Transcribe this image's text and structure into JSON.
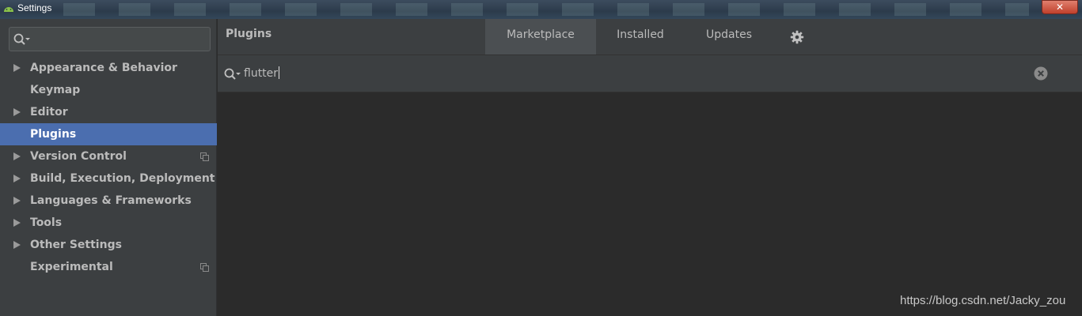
{
  "window": {
    "title": "Settings",
    "close_glyph": "✕"
  },
  "sidebar": {
    "search": {
      "value": "",
      "placeholder": ""
    },
    "items": [
      {
        "label": "Appearance & Behavior",
        "expandable": true,
        "selected": false,
        "has_project_icon": false
      },
      {
        "label": "Keymap",
        "expandable": false,
        "selected": false,
        "has_project_icon": false
      },
      {
        "label": "Editor",
        "expandable": true,
        "selected": false,
        "has_project_icon": false
      },
      {
        "label": "Plugins",
        "expandable": false,
        "selected": true,
        "has_project_icon": false
      },
      {
        "label": "Version Control",
        "expandable": true,
        "selected": false,
        "has_project_icon": true
      },
      {
        "label": "Build, Execution, Deployment",
        "expandable": true,
        "selected": false,
        "has_project_icon": false
      },
      {
        "label": "Languages & Frameworks",
        "expandable": true,
        "selected": false,
        "has_project_icon": false
      },
      {
        "label": "Tools",
        "expandable": true,
        "selected": false,
        "has_project_icon": false
      },
      {
        "label": "Other Settings",
        "expandable": true,
        "selected": false,
        "has_project_icon": false
      },
      {
        "label": "Experimental",
        "expandable": false,
        "selected": false,
        "has_project_icon": true
      }
    ]
  },
  "main": {
    "title": "Plugins",
    "tabs": [
      {
        "label": "Marketplace",
        "active": true
      },
      {
        "label": "Installed",
        "active": false
      },
      {
        "label": "Updates",
        "active": false
      }
    ],
    "settings_icon": "gear-icon",
    "search": {
      "value": "flutter"
    }
  },
  "watermark": "https://blog.csdn.net/Jacky_zou",
  "colors": {
    "selection": "#4b6eaf",
    "panel": "#3c3f41",
    "content": "#2b2b2b",
    "text": "#bbbbbb"
  }
}
